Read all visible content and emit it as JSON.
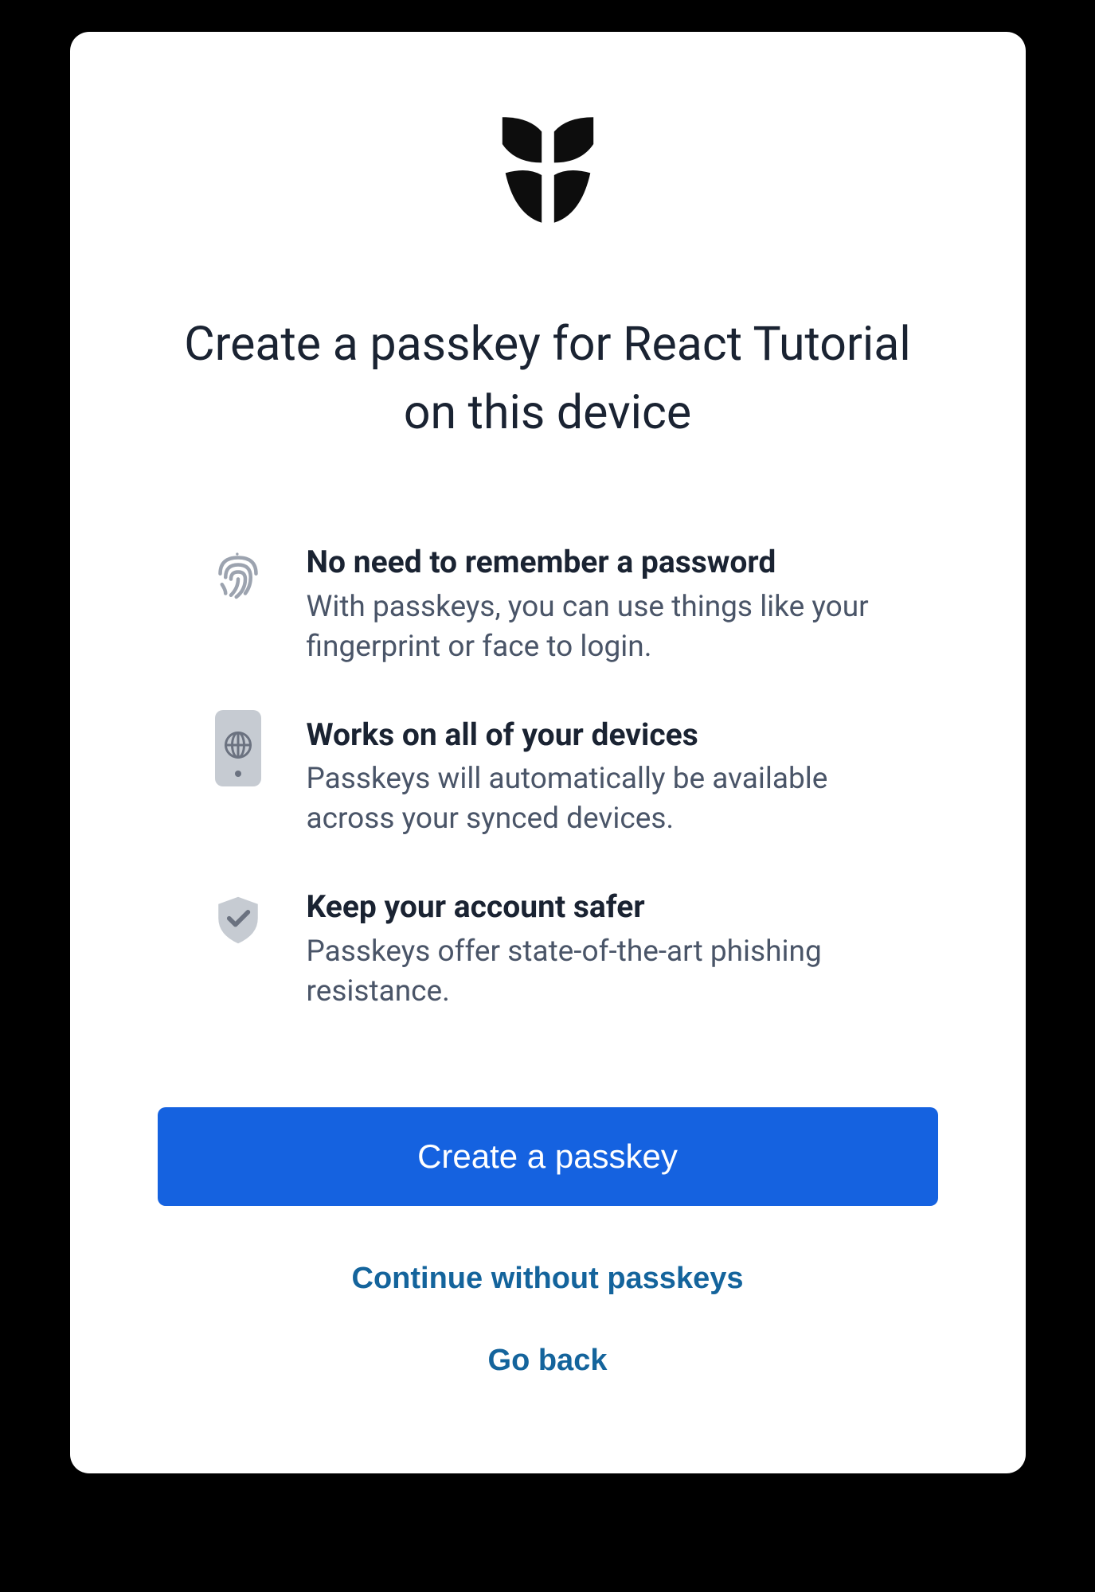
{
  "title": "Create a passkey for React Tutorial on this device",
  "benefits": [
    {
      "title": "No need to remember a password",
      "description": "With passkeys, you can use things like your fingerprint or face to login."
    },
    {
      "title": "Works on all of your devices",
      "description": "Passkeys will automatically be available across your synced devices."
    },
    {
      "title": "Keep your account safer",
      "description": "Passkeys offer state-of-the-art phishing resistance."
    }
  ],
  "buttons": {
    "primary": "Create a passkey",
    "secondary": "Continue without passkeys",
    "tertiary": "Go back"
  }
}
